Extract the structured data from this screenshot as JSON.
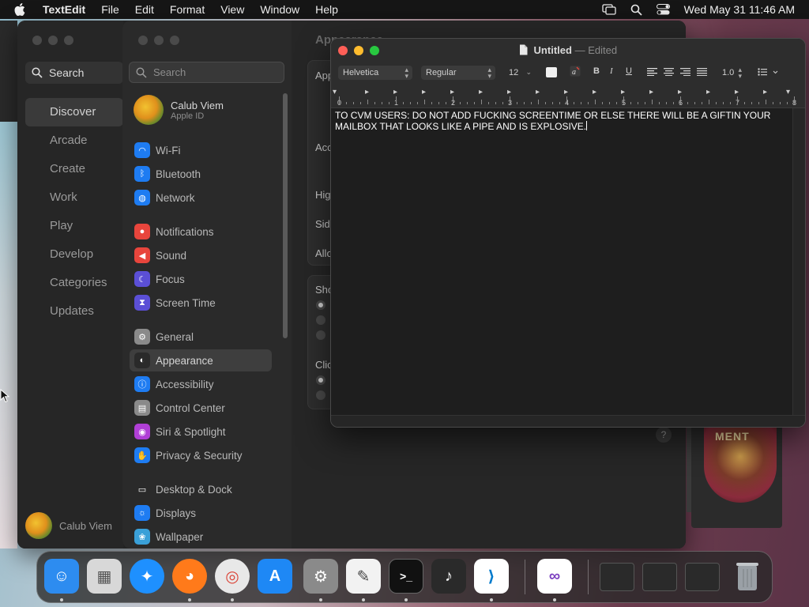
{
  "menubar": {
    "app_name": "TextEdit",
    "items": [
      "File",
      "Edit",
      "Format",
      "View",
      "Window",
      "Help"
    ],
    "clock": "Wed May 31  11:46 AM"
  },
  "app_store": {
    "search_placeholder": "Search",
    "nav": [
      "Discover",
      "Arcade",
      "Create",
      "Work",
      "Play",
      "Develop",
      "Categories",
      "Updates"
    ],
    "active_nav": "Discover",
    "user_name": "Calub Viem"
  },
  "settings": {
    "search_placeholder": "Search",
    "profile": {
      "name": "Calub Viem",
      "subtitle": "Apple ID"
    },
    "items": [
      {
        "label": "Wi-Fi",
        "icon": "wifi-icon",
        "color": "#1e7cf2"
      },
      {
        "label": "Bluetooth",
        "icon": "bluetooth-icon",
        "color": "#1e7cf2"
      },
      {
        "label": "Network",
        "icon": "globe-icon",
        "color": "#1e7cf2"
      },
      {
        "label": "Notifications",
        "icon": "bell-icon",
        "color": "#e8453c"
      },
      {
        "label": "Sound",
        "icon": "speaker-icon",
        "color": "#e8453c"
      },
      {
        "label": "Focus",
        "icon": "moon-icon",
        "color": "#5b4fd6"
      },
      {
        "label": "Screen Time",
        "icon": "hourglass-icon",
        "color": "#5b4fd6"
      },
      {
        "label": "General",
        "icon": "gear-icon",
        "color": "#8a8a8a"
      },
      {
        "label": "Appearance",
        "icon": "appearance-icon",
        "color": "#2a2a2a"
      },
      {
        "label": "Accessibility",
        "icon": "accessibility-icon",
        "color": "#1e7cf2"
      },
      {
        "label": "Control Center",
        "icon": "control-center-icon",
        "color": "#8a8a8a"
      },
      {
        "label": "Siri & Spotlight",
        "icon": "siri-icon",
        "color": "#b03fd6"
      },
      {
        "label": "Privacy & Security",
        "icon": "hand-icon",
        "color": "#1e7cf2"
      },
      {
        "label": "Desktop & Dock",
        "icon": "desktop-icon",
        "color": "#2a2a2a"
      },
      {
        "label": "Displays",
        "icon": "displays-icon",
        "color": "#1e7cf2"
      },
      {
        "label": "Wallpaper",
        "icon": "wallpaper-icon",
        "color": "#3aa0d8"
      }
    ],
    "active_item": "Appearance",
    "content": {
      "title": "Appearance",
      "labels": [
        "App",
        "Acc",
        "Hig",
        "Sid",
        "Allo",
        "Sho",
        "Clic"
      ]
    },
    "wallpaper_text": "MENT"
  },
  "textedit": {
    "title": "Untitled",
    "title_sep": "—",
    "status": "Edited",
    "font_family": "Helvetica",
    "font_style": "Regular",
    "font_size": "12",
    "line_spacing": "1.0",
    "ruler_numbers": [
      "0",
      "1",
      "2",
      "3",
      "4",
      "5",
      "6",
      "7",
      "8"
    ],
    "body_text": "TO CVM USERS: DO NOT ADD FUCKING SCREENTIME OR ELSE THERE WILL BE A  GIFTIN YOUR MAILBOX THAT LOOKS LIKE A PIPE AND IS EXPLOSIVE."
  },
  "dock": {
    "apps": [
      {
        "name": "finder",
        "color": "#2d8cf0"
      },
      {
        "name": "launchpad",
        "color": "#d8d8d8"
      },
      {
        "name": "safari",
        "color": "#1e90ff"
      },
      {
        "name": "firefox",
        "color": "#ff7a1a"
      },
      {
        "name": "chrome",
        "color": "#e8e8e8"
      },
      {
        "name": "app-store",
        "color": "#1e88f5"
      },
      {
        "name": "system-settings",
        "color": "#8a8a8a"
      },
      {
        "name": "textedit",
        "color": "#f2f2f2"
      },
      {
        "name": "terminal",
        "color": "#111111"
      },
      {
        "name": "garageband",
        "color": "#2a2a2a"
      },
      {
        "name": "vscode",
        "color": "#ffffff"
      },
      {
        "name": "visual-studio",
        "color": "#ffffff"
      }
    ]
  }
}
